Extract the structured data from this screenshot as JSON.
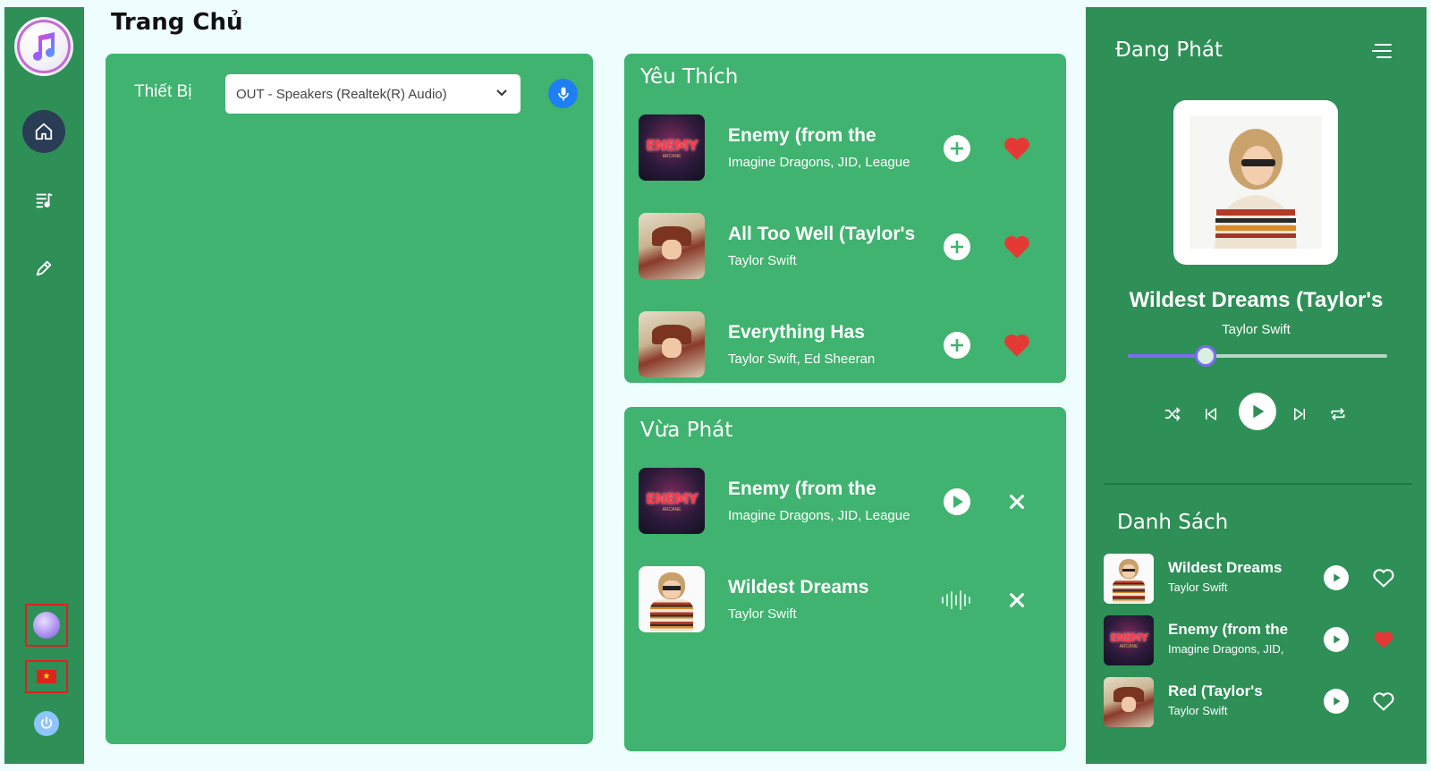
{
  "page": {
    "title": "Trang Chủ"
  },
  "sidebar": {
    "items": [
      {
        "name": "home",
        "icon": "home-icon",
        "active": true
      },
      {
        "name": "playlist",
        "icon": "music-list-icon"
      },
      {
        "name": "edit",
        "icon": "pen-icon"
      }
    ],
    "theme_icon": "moon-icon",
    "language_icon": "vietnam-flag-icon",
    "power_icon": "power-icon"
  },
  "device": {
    "label": "Thiết Bị",
    "selected": "OUT - Speakers (Realtek(R) Audio)",
    "mic_icon": "microphone-icon"
  },
  "favorites": {
    "title": "Yêu Thích",
    "songs": [
      {
        "title": "Enemy (from the",
        "artist": "Imagine Dragons, JID, League",
        "cover": "enemy"
      },
      {
        "title": "All Too Well (Taylor's",
        "artist": "Taylor Swift",
        "cover": "red"
      },
      {
        "title": "Everything Has",
        "artist": "Taylor Swift, Ed Sheeran",
        "cover": "red"
      }
    ]
  },
  "recent": {
    "title": "Vừa Phát",
    "songs": [
      {
        "title": "Enemy (from the",
        "artist": "Imagine Dragons, JID, League",
        "cover": "enemy",
        "state": "play"
      },
      {
        "title": "Wildest Dreams",
        "artist": "Taylor Swift",
        "cover": "wildest",
        "state": "playing"
      }
    ]
  },
  "now_playing": {
    "header": "Đang Phát",
    "title": "Wildest Dreams (Taylor's",
    "artist": "Taylor Swift",
    "progress": 0.3
  },
  "queue": {
    "title": "Danh Sách",
    "songs": [
      {
        "title": "Wildest Dreams",
        "artist": "Taylor Swift",
        "cover": "wildest",
        "liked": false
      },
      {
        "title": "Enemy (from the",
        "artist": "Imagine Dragons, JID,",
        "cover": "enemy",
        "liked": true
      },
      {
        "title": "Red (Taylor's",
        "artist": "Taylor Swift",
        "cover": "red",
        "liked": false
      }
    ]
  },
  "colors": {
    "sidebar": "#2e8f57",
    "panel": "#3fb36f",
    "heart": "#e53935",
    "accent": "#7b6cf0",
    "mic": "#1d7ff2"
  }
}
